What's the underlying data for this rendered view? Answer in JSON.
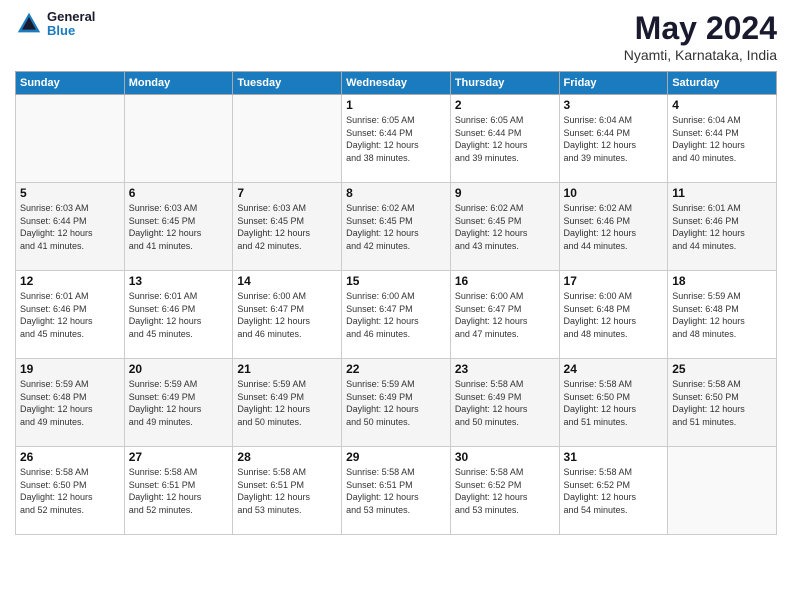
{
  "logo": {
    "line1": "General",
    "line2": "Blue"
  },
  "title": "May 2024",
  "subtitle": "Nyamti, Karnataka, India",
  "days_of_week": [
    "Sunday",
    "Monday",
    "Tuesday",
    "Wednesday",
    "Thursday",
    "Friday",
    "Saturday"
  ],
  "weeks": [
    [
      {
        "day": "",
        "info": ""
      },
      {
        "day": "",
        "info": ""
      },
      {
        "day": "",
        "info": ""
      },
      {
        "day": "1",
        "info": "Sunrise: 6:05 AM\nSunset: 6:44 PM\nDaylight: 12 hours\nand 38 minutes."
      },
      {
        "day": "2",
        "info": "Sunrise: 6:05 AM\nSunset: 6:44 PM\nDaylight: 12 hours\nand 39 minutes."
      },
      {
        "day": "3",
        "info": "Sunrise: 6:04 AM\nSunset: 6:44 PM\nDaylight: 12 hours\nand 39 minutes."
      },
      {
        "day": "4",
        "info": "Sunrise: 6:04 AM\nSunset: 6:44 PM\nDaylight: 12 hours\nand 40 minutes."
      }
    ],
    [
      {
        "day": "5",
        "info": "Sunrise: 6:03 AM\nSunset: 6:44 PM\nDaylight: 12 hours\nand 41 minutes."
      },
      {
        "day": "6",
        "info": "Sunrise: 6:03 AM\nSunset: 6:45 PM\nDaylight: 12 hours\nand 41 minutes."
      },
      {
        "day": "7",
        "info": "Sunrise: 6:03 AM\nSunset: 6:45 PM\nDaylight: 12 hours\nand 42 minutes."
      },
      {
        "day": "8",
        "info": "Sunrise: 6:02 AM\nSunset: 6:45 PM\nDaylight: 12 hours\nand 42 minutes."
      },
      {
        "day": "9",
        "info": "Sunrise: 6:02 AM\nSunset: 6:45 PM\nDaylight: 12 hours\nand 43 minutes."
      },
      {
        "day": "10",
        "info": "Sunrise: 6:02 AM\nSunset: 6:46 PM\nDaylight: 12 hours\nand 44 minutes."
      },
      {
        "day": "11",
        "info": "Sunrise: 6:01 AM\nSunset: 6:46 PM\nDaylight: 12 hours\nand 44 minutes."
      }
    ],
    [
      {
        "day": "12",
        "info": "Sunrise: 6:01 AM\nSunset: 6:46 PM\nDaylight: 12 hours\nand 45 minutes."
      },
      {
        "day": "13",
        "info": "Sunrise: 6:01 AM\nSunset: 6:46 PM\nDaylight: 12 hours\nand 45 minutes."
      },
      {
        "day": "14",
        "info": "Sunrise: 6:00 AM\nSunset: 6:47 PM\nDaylight: 12 hours\nand 46 minutes."
      },
      {
        "day": "15",
        "info": "Sunrise: 6:00 AM\nSunset: 6:47 PM\nDaylight: 12 hours\nand 46 minutes."
      },
      {
        "day": "16",
        "info": "Sunrise: 6:00 AM\nSunset: 6:47 PM\nDaylight: 12 hours\nand 47 minutes."
      },
      {
        "day": "17",
        "info": "Sunrise: 6:00 AM\nSunset: 6:48 PM\nDaylight: 12 hours\nand 48 minutes."
      },
      {
        "day": "18",
        "info": "Sunrise: 5:59 AM\nSunset: 6:48 PM\nDaylight: 12 hours\nand 48 minutes."
      }
    ],
    [
      {
        "day": "19",
        "info": "Sunrise: 5:59 AM\nSunset: 6:48 PM\nDaylight: 12 hours\nand 49 minutes."
      },
      {
        "day": "20",
        "info": "Sunrise: 5:59 AM\nSunset: 6:49 PM\nDaylight: 12 hours\nand 49 minutes."
      },
      {
        "day": "21",
        "info": "Sunrise: 5:59 AM\nSunset: 6:49 PM\nDaylight: 12 hours\nand 50 minutes."
      },
      {
        "day": "22",
        "info": "Sunrise: 5:59 AM\nSunset: 6:49 PM\nDaylight: 12 hours\nand 50 minutes."
      },
      {
        "day": "23",
        "info": "Sunrise: 5:58 AM\nSunset: 6:49 PM\nDaylight: 12 hours\nand 50 minutes."
      },
      {
        "day": "24",
        "info": "Sunrise: 5:58 AM\nSunset: 6:50 PM\nDaylight: 12 hours\nand 51 minutes."
      },
      {
        "day": "25",
        "info": "Sunrise: 5:58 AM\nSunset: 6:50 PM\nDaylight: 12 hours\nand 51 minutes."
      }
    ],
    [
      {
        "day": "26",
        "info": "Sunrise: 5:58 AM\nSunset: 6:50 PM\nDaylight: 12 hours\nand 52 minutes."
      },
      {
        "day": "27",
        "info": "Sunrise: 5:58 AM\nSunset: 6:51 PM\nDaylight: 12 hours\nand 52 minutes."
      },
      {
        "day": "28",
        "info": "Sunrise: 5:58 AM\nSunset: 6:51 PM\nDaylight: 12 hours\nand 53 minutes."
      },
      {
        "day": "29",
        "info": "Sunrise: 5:58 AM\nSunset: 6:51 PM\nDaylight: 12 hours\nand 53 minutes."
      },
      {
        "day": "30",
        "info": "Sunrise: 5:58 AM\nSunset: 6:52 PM\nDaylight: 12 hours\nand 53 minutes."
      },
      {
        "day": "31",
        "info": "Sunrise: 5:58 AM\nSunset: 6:52 PM\nDaylight: 12 hours\nand 54 minutes."
      },
      {
        "day": "",
        "info": ""
      }
    ]
  ]
}
